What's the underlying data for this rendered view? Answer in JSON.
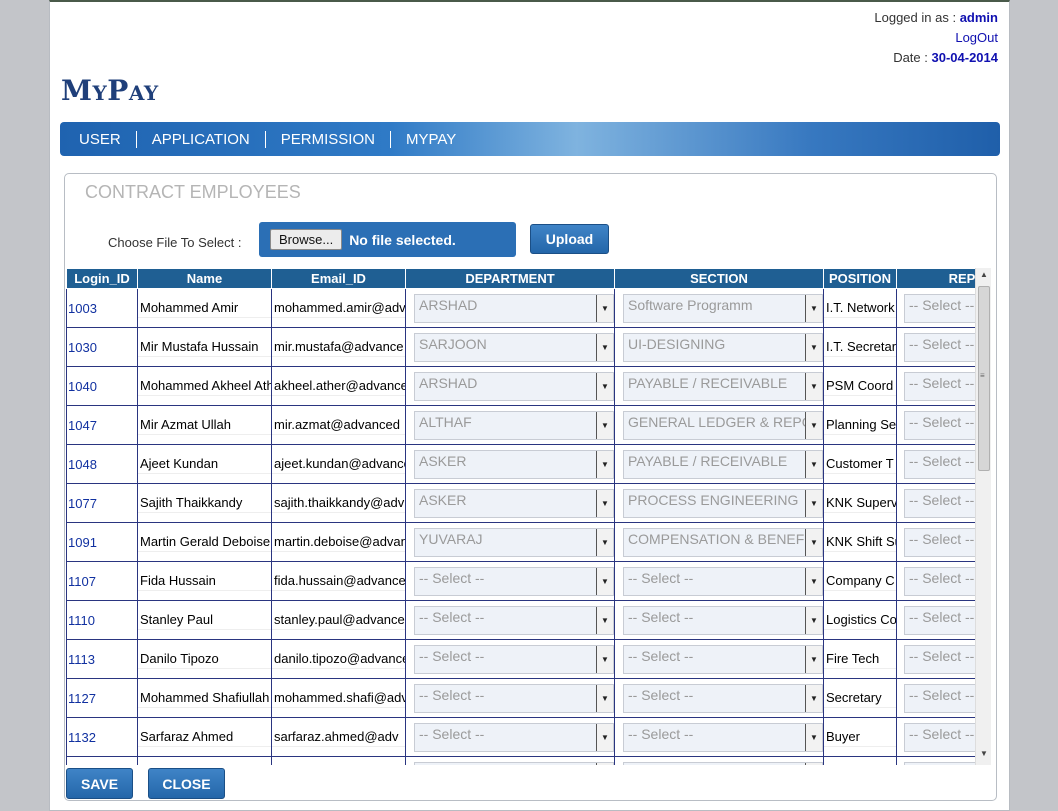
{
  "header": {
    "logged_in_label": "Logged in as :",
    "user": "admin",
    "logout": "LogOut",
    "date_label": "Date :",
    "date": "30-04-2014",
    "logo_m": "M",
    "logo_y": "Y",
    "logo_p": "P",
    "logo_ay": "AY"
  },
  "nav": [
    "USER",
    "APPLICATION",
    "PERMISSION",
    "MYPAY"
  ],
  "panel": {
    "title": "CONTRACT EMPLOYEES",
    "file_label": "Choose File To Select :",
    "browse": "Browse...",
    "no_file": "No file selected.",
    "upload": "Upload"
  },
  "columns": [
    "Login_ID",
    "Name",
    "Email_ID",
    "DEPARTMENT",
    "SECTION",
    "POSITION",
    "REP"
  ],
  "rows": [
    {
      "id": "1003",
      "name": "Mohammed Amir",
      "email": "mohammed.amir@advance",
      "dept": "ARSHAD",
      "section": "Software Programm",
      "position": "I.T. Network",
      "rep": "-- Select --"
    },
    {
      "id": "1030",
      "name": "Mir Mustafa Hussain",
      "email": "mir.mustafa@advance",
      "dept": "SARJOON",
      "section": "UI-DESIGNING",
      "position": "I.T. Secretary",
      "rep": "-- Select --"
    },
    {
      "id": "1040",
      "name": "Mohammed Akheel Ather",
      "email": "akheel.ather@advanced",
      "dept": "ARSHAD",
      "section": "PAYABLE / RECEIVABLE",
      "position": "PSM Coord",
      "rep": "-- Select --"
    },
    {
      "id": "1047",
      "name": "Mir Azmat Ullah",
      "email": "mir.azmat@advanced",
      "dept": "ALTHAF",
      "section": "GENERAL LEDGER & REPORTING",
      "position": "Planning Se",
      "rep": "-- Select --"
    },
    {
      "id": "1048",
      "name": "Ajeet Kundan",
      "email": "ajeet.kundan@advanced",
      "dept": "ASKER",
      "section": "PAYABLE / RECEIVABLE",
      "position": "Customer T",
      "rep": "-- Select --"
    },
    {
      "id": "1077",
      "name": "Sajith Thaikkandy",
      "email": "sajith.thaikkandy@adv",
      "dept": "ASKER",
      "section": "PROCESS ENGINEERING",
      "position": "KNK Superv",
      "rep": "-- Select --"
    },
    {
      "id": "1091",
      "name": "Martin Gerald Deboise",
      "email": "martin.deboise@advan",
      "dept": "YUVARAJ",
      "section": "COMPENSATION & BENEFITS",
      "position": "KNK Shift Su",
      "rep": "-- Select --"
    },
    {
      "id": "1107",
      "name": "Fida Hussain",
      "email": "fida.hussain@advanced",
      "dept": "-- Select --",
      "section": "-- Select --",
      "position": "Company C",
      "rep": "-- Select --"
    },
    {
      "id": "1110",
      "name": "Stanley Paul",
      "email": "stanley.paul@advanced",
      "dept": "-- Select --",
      "section": "-- Select --",
      "position": "Logistics Co",
      "rep": "-- Select --"
    },
    {
      "id": "1113",
      "name": "Danilo Tipozo",
      "email": "danilo.tipozo@advanced",
      "dept": "-- Select --",
      "section": "-- Select --",
      "position": "Fire Tech",
      "rep": "-- Select --"
    },
    {
      "id": "1127",
      "name": "Mohammed Shafiullah",
      "email": "mohammed.shafi@adv",
      "dept": "-- Select --",
      "section": "-- Select --",
      "position": "Secretary",
      "rep": "-- Select --"
    },
    {
      "id": "1132",
      "name": "Sarfaraz Ahmed",
      "email": "sarfaraz.ahmed@adv",
      "dept": "-- Select --",
      "section": "-- Select --",
      "position": "Buyer",
      "rep": "-- Select --"
    },
    {
      "id": "",
      "name": "",
      "email": "",
      "dept": "",
      "section": "",
      "position": "",
      "rep": ""
    }
  ],
  "actions": {
    "save": "SAVE",
    "close": "CLOSE"
  }
}
